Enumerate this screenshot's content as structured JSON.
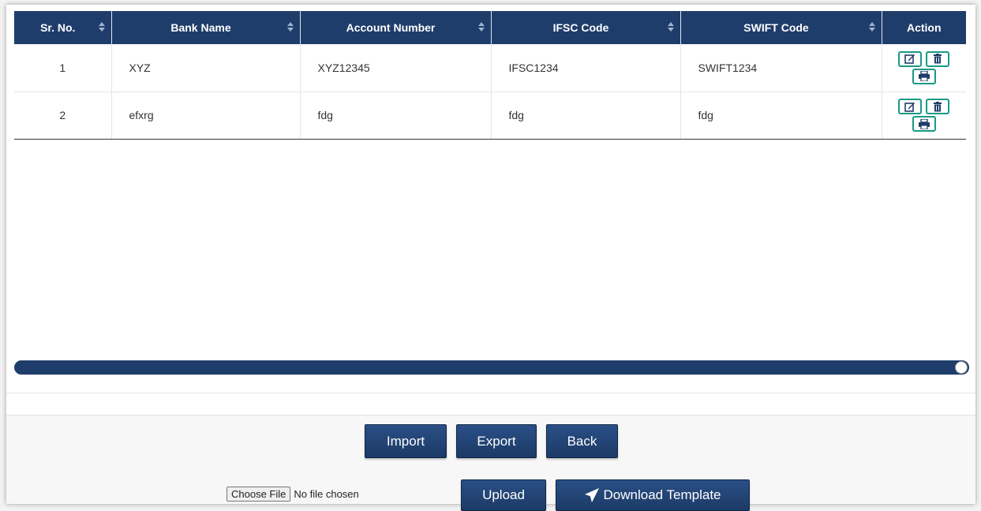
{
  "table": {
    "headers": [
      "Sr. No.",
      "Bank Name",
      "Account Number",
      "IFSC Code",
      "SWIFT Code",
      "Action"
    ],
    "rows": [
      {
        "sr": "1",
        "bank": "XYZ",
        "account": "XYZ12345",
        "ifsc": "IFSC1234",
        "swift": "SWIFT1234"
      },
      {
        "sr": "2",
        "bank": "efxrg",
        "account": "fdg",
        "ifsc": "fdg",
        "swift": "fdg"
      }
    ],
    "action_icons": [
      "edit-icon",
      "delete-icon",
      "print-icon"
    ]
  },
  "buttons": {
    "import": "Import",
    "export": "Export",
    "back": "Back",
    "upload": "Upload",
    "download_template": "Download Template"
  },
  "file_input": {
    "button_label": "Choose File",
    "status": "No file chosen"
  },
  "colors": {
    "header_bg": "#1f3d6b",
    "action_border": "#1a9a86",
    "button_bg": "#1f3d6b"
  }
}
